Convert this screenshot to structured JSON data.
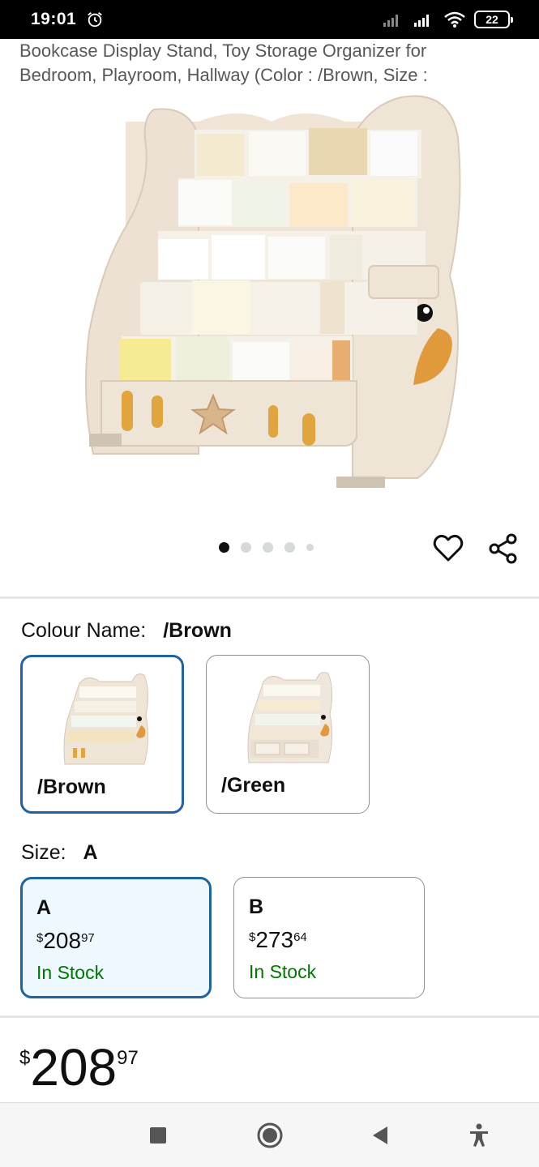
{
  "status_bar": {
    "time": "19:01",
    "battery": "22"
  },
  "product": {
    "title_lines": [
      "Bookcase Display Stand, Toy Storage Organizer for",
      "Bedroom, Playroom, Hallway (Color : /Brown, Size :"
    ]
  },
  "carousel": {
    "total_images": 5,
    "active_index": 0
  },
  "colour": {
    "label": "Colour Name:",
    "selected": "/Brown",
    "options": [
      {
        "label": "/Brown"
      },
      {
        "label": "/Green"
      }
    ]
  },
  "size": {
    "label": "Size:",
    "selected": "A",
    "options": [
      {
        "name": "A",
        "currency": "$",
        "whole": "208",
        "fraction": "97",
        "stock": "In Stock"
      },
      {
        "name": "B",
        "currency": "$",
        "whole": "273",
        "fraction": "64",
        "stock": "In Stock"
      }
    ]
  },
  "price": {
    "currency": "$",
    "whole": "208",
    "fraction": "97"
  },
  "colors": {
    "selected_border": "#2162a1",
    "selected_bg": "#edf8ff",
    "in_stock": "#007600"
  }
}
